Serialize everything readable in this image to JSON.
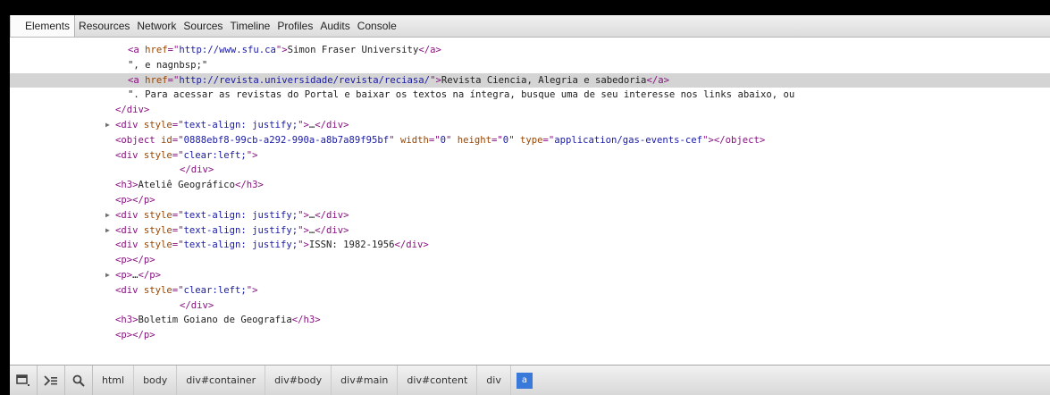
{
  "tabs": [
    "Elements",
    "Resources",
    "Network",
    "Sources",
    "Timeline",
    "Profiles",
    "Audits",
    "Console"
  ],
  "tree": {
    "l1": {
      "tag_open": "<a ",
      "attr1": "href",
      "eq": "=\"",
      "val1": "http://www.sfu.ca",
      "close": "\">",
      "text": "Simon Fraser University",
      "tag_close": "</a>"
    },
    "l2": {
      "text": "\", e nagnbsp;\""
    },
    "l3": {
      "tag_open": "<a ",
      "attr1": "href",
      "eq": "=\"",
      "val1": "http://revista.universidade/revista/reciasa/",
      "close": "\">",
      "text": "Revista Ciencia, Alegria e sabedoria",
      "tag_close": "</a>"
    },
    "l4": {
      "text": "\". Para acessar as revistas do Portal e baixar os textos na íntegra, busque uma de seu interesse nos links abaixo, ou"
    },
    "l5": {
      "tag": "</div>"
    },
    "l6": {
      "tag_open": "<div ",
      "attr1": "style",
      "eq": "=\"",
      "val1": "text-align: justify;",
      "close": "\">",
      "ellipsis": "…",
      "tag_close": "</div>"
    },
    "l7": {
      "tag_open": "<object ",
      "attr1": "id",
      "val1": "0888ebf8-99cb-a292-990a-a8b7a89f95bf",
      "attr2": "width",
      "val2": "0",
      "attr3": "height",
      "val3": "0",
      "attr4": "type",
      "val4": "application/gas-events-cef",
      "tag_close": "></object>"
    },
    "l8": {
      "tag_open": "<div ",
      "attr1": "style",
      "eq": "=\"",
      "val1": "clear:left;",
      "close": "\">"
    },
    "l9": {
      "tag": "</div>"
    },
    "l10": {
      "tag_open": "<h3>",
      "text": "Ateliê Geográfico",
      "tag_close": "</h3>"
    },
    "l11": {
      "tag": "<p></p>"
    },
    "l12": {
      "tag_open": "<div ",
      "attr1": "style",
      "eq": "=\"",
      "val1": "text-align: justify;",
      "close": "\">",
      "ellipsis": "…",
      "tag_close": "</div>"
    },
    "l13": {
      "tag_open": "<div ",
      "attr1": "style",
      "eq": "=\"",
      "val1": "text-align: justify;",
      "close": "\">",
      "ellipsis": "…",
      "tag_close": "</div>"
    },
    "l14": {
      "tag_open": "<div ",
      "attr1": "style",
      "eq": "=\"",
      "val1": "text-align: justify;",
      "close": "\">",
      "text": "ISSN: 1982-1956",
      "tag_close": "</div>"
    },
    "l15": {
      "tag": "<p></p>"
    },
    "l16": {
      "tag_open": "<p>",
      "ellipsis": "…",
      "tag_close": "</p>"
    },
    "l17": {
      "tag_open": "<div ",
      "attr1": "style",
      "eq": "=\"",
      "val1": "clear:left;",
      "close": "\">"
    },
    "l18": {
      "tag": "</div>"
    },
    "l19": {
      "tag_open": "<h3>",
      "text": "Boletim Goiano de Geografia",
      "tag_close": "</h3>"
    },
    "l20": {
      "tag": "<p></p>"
    }
  },
  "breadcrumbs": [
    "html",
    "body",
    "div#container",
    "div#body",
    "div#main",
    "div#content",
    "div",
    "a"
  ],
  "colors": {
    "tag": "#881280",
    "attr_name": "#994500",
    "attr_value": "#1a1aa6",
    "selected_row": "#d4d4d4",
    "selected_crumb": "#3879d9"
  }
}
